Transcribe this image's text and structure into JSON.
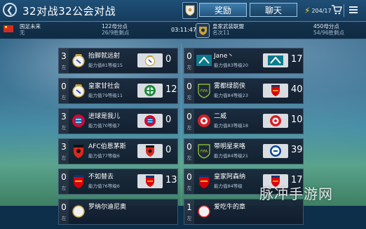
{
  "header": {
    "title": "32对战32公会对战",
    "tab_reward": "奖励",
    "tab_chat": "聊天",
    "energy": "204/17"
  },
  "infobar": {
    "left_team_name": "国足未来",
    "left_team_sub": "无",
    "left_score_main": "122母分点",
    "left_score_sub": "26/9胜剩点",
    "timer": "03:11:47",
    "right_team_name": "皇家武装联盟",
    "right_team_sub": "名次11",
    "right_score_main": "450母分点",
    "right_score_sub": "54/96胜剩点"
  },
  "left_matches": [
    {
      "num": "3",
      "side": "左",
      "name": "抬脚就远射",
      "stats": "能力值81等级15",
      "score": "0"
    },
    {
      "num": "0",
      "side": "左",
      "name": "皇家甘社会",
      "stats": "能力值79等级11",
      "score": "12"
    },
    {
      "num": "3",
      "side": "左",
      "name": "进球是我儿",
      "stats": "能力值70等级7",
      "score": "0"
    },
    {
      "num": "3",
      "side": "左",
      "name": "AFC伯恩茅斯",
      "stats": "能力值77等级6",
      "score": "0"
    },
    {
      "num": "0",
      "side": "左",
      "name": "不如替去",
      "stats": "能力值76等级6",
      "score": "13"
    },
    {
      "num": "0",
      "side": "左",
      "name": "罗纳尔迪尼奥",
      "stats": "",
      "score": ""
    }
  ],
  "right_matches": [
    {
      "num": "0",
      "side": "左",
      "name": "Jane丶",
      "stats": "能力值83等级20",
      "score": "17"
    },
    {
      "num": "0",
      "side": "左",
      "name": "雾都绿箭侠",
      "stats": "能力值84等级23",
      "score": "40"
    },
    {
      "num": "0",
      "side": "左",
      "name": "二威",
      "stats": "能力值83等级18",
      "score": "10"
    },
    {
      "num": "0",
      "side": "左",
      "name": "带明星来咯",
      "stats": "能力值84等级21",
      "score": "39"
    },
    {
      "num": "0",
      "side": "左",
      "name": "皇家阿森纳",
      "stats": "能力值84等级",
      "score": "17"
    },
    {
      "num": "1",
      "side": "左",
      "name": "爱吃牛的章",
      "stats": "",
      "score": ""
    }
  ],
  "watermark": "脉冲手游网",
  "colors": {
    "accent": "#4d86b2",
    "text": "#ffffff",
    "energy_bolt": "#f5d232"
  }
}
